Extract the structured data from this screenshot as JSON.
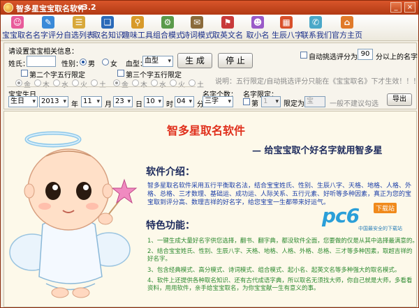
{
  "window": {
    "title": "智多星宝宝取名软件",
    "version": "v3.2",
    "minimize_label": "_",
    "close_label": "×"
  },
  "toolbar": {
    "items": [
      {
        "label": "宝宝取名",
        "icon": "baby-icon",
        "color": "#e85a9a",
        "glyph": "☺"
      },
      {
        "label": "名字评分",
        "icon": "pen-icon",
        "color": "#3a8ad8",
        "glyph": "✎"
      },
      {
        "label": "自选列表",
        "icon": "list-icon",
        "color": "#d8a83a",
        "glyph": "☰"
      },
      {
        "label": "取名知识",
        "icon": "book-icon",
        "color": "#2a6ab8",
        "glyph": "❏"
      },
      {
        "label": "趣味工具",
        "icon": "magnifier-icon",
        "color": "#d89a2a",
        "glyph": "⚲"
      },
      {
        "label": "组合模式",
        "icon": "gear-icon",
        "color": "#5a9a4a",
        "glyph": "⚙"
      },
      {
        "label": "诗词模式",
        "icon": "scroll-icon",
        "color": "#8a6a3a",
        "glyph": "✉"
      },
      {
        "label": "取英文名",
        "icon": "flag-icon",
        "color": "#c83a3a",
        "glyph": "⚑"
      },
      {
        "label": "取小名",
        "icon": "child-icon",
        "color": "#9a5ac8",
        "glyph": "☻"
      },
      {
        "label": "生辰八字",
        "icon": "calendar-icon",
        "color": "#d8502a",
        "glyph": "▦"
      },
      {
        "label": "联系我们",
        "icon": "contact-icon",
        "color": "#4aa8c8",
        "glyph": "✆"
      },
      {
        "label": "官方主页",
        "icon": "home-icon",
        "color": "#e07a2a",
        "glyph": "⌂"
      }
    ]
  },
  "settings": {
    "group_title": "请设置宝宝相关信息：",
    "surname_label": "姓氏：",
    "surname_value": "",
    "gender_label": "性别：",
    "gender_male": "男",
    "gender_female": "女",
    "blood_label": "血型：",
    "blood_value": "血型",
    "generate_button": "生 成",
    "stop_button": "停 止",
    "auto_filter_label": "自动挑选评分为",
    "auto_filter_value": "90",
    "auto_filter_suffix": "分以上的名字",
    "note": "说明：五行限定/自动挑选评分只能在《宝宝取名》下才生效！！！！！",
    "second_char_label": "第二个字五行限定",
    "third_char_label": "第三个字五行限定",
    "elements": [
      "金",
      "木",
      "水",
      "火",
      "土"
    ],
    "birthday_label": "宝宝生日",
    "calendar_value": "生日",
    "year_value": "2013",
    "year_label": "年",
    "month_value": "11",
    "month_label": "月",
    "day_value": "23",
    "day_label": "日",
    "hour_value": "10",
    "hour_label": "时",
    "minute_value": "04",
    "minute_label": "分",
    "count_label": "名字个数：",
    "count_value": "三字",
    "limit_label": "名字限定：",
    "limit_check_label": "第",
    "limit_select_value": "1",
    "limit_select_label": "限定为",
    "limit_input_value": "宝",
    "limit_hint": "一般不建议勾选",
    "export_button": "导出"
  },
  "content": {
    "headline": "智多星取名软件",
    "slogan": "— 给宝宝取个好名字就用智多星",
    "intro_title": "软件介绍：",
    "intro_text": "智多星取名软件采用五行平衡取名法，结合宝宝姓氏、性别、生辰八字、天格、地格、人格、外格、总格、三才数理、基础运、成功运、人际关系、五行元素、好听等多种因素，真正为您的宝宝取到评分高、数理吉祥的好名字，给您宝宝一生都带来好运气。",
    "features_title": "特色功能：",
    "features": [
      "1、一键生成大量好名字供您选择，翻书、翻字典，都没软件全面，您要做的仅是从其中选择最满意的。",
      "2、结合宝宝姓氏、性别、生辰八字、天格、地格、人格、外格、总格、三才等多种因素，取超吉祥的好名字。",
      "3、包含经典模式、高分模式、诗词模式、组合模式、起小名、起英文名等多种强大的取名模式。",
      "4、软件上还提供各种取名知识、还有古代成语字典，所以取名无须找大师，你自己就是大师，多看看资料，用用软件，亲手给宝宝取名，为你宝宝献一生有意义的事。"
    ],
    "watermark_text": "pc6",
    "watermark_badge": "下载站",
    "watermark_sub": "中国最安全的下载站"
  },
  "colors": {
    "title_bar": "#c2461a",
    "headline": "#e0301c",
    "intro_text": "#1c3fa8",
    "feature_text": "#2d8a30"
  }
}
